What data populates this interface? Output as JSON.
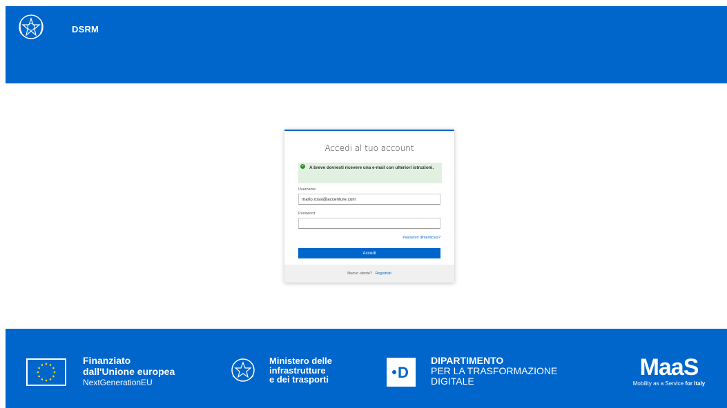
{
  "header": {
    "brand": "DSRM",
    "emblem_icon": "republic-emblem-icon"
  },
  "login": {
    "title": "Accedi al tuo account",
    "alert": {
      "icon": "check-circle-icon",
      "message": "A breve dovresti ricevere una e-mail con ulteriori istruzioni."
    },
    "username_label": "Username",
    "username_value": "mario.rossi@accenture.com",
    "password_label": "Password",
    "password_value": "",
    "forgot_link": "Password dimenticata?",
    "submit_label": "Accedi",
    "footer_prompt": "Nuovo utente?",
    "register_link": "Registrati"
  },
  "footer": {
    "eu": {
      "line1": "Finanziato",
      "line2": "dall'Unione europea",
      "line3": "NextGenerationEU",
      "icon": "eu-flag-icon"
    },
    "ministry": {
      "line1": "Ministero delle",
      "line2": "infrastrutture",
      "line3": "e dei trasporti",
      "icon": "republic-emblem-icon"
    },
    "department": {
      "logo_letter": "D",
      "line1": "DIPARTIMENTO",
      "line2": "PER LA TRASFORMAZIONE",
      "line3": "DIGITALE"
    },
    "maas": {
      "logo": "MaaS",
      "tag_normal": "Mobility as a Service",
      "tag_bold": "for Italy"
    }
  },
  "colors": {
    "primary": "#0066cc",
    "success_bg": "#e1f0e1",
    "success_icon": "#2e8b2e"
  }
}
